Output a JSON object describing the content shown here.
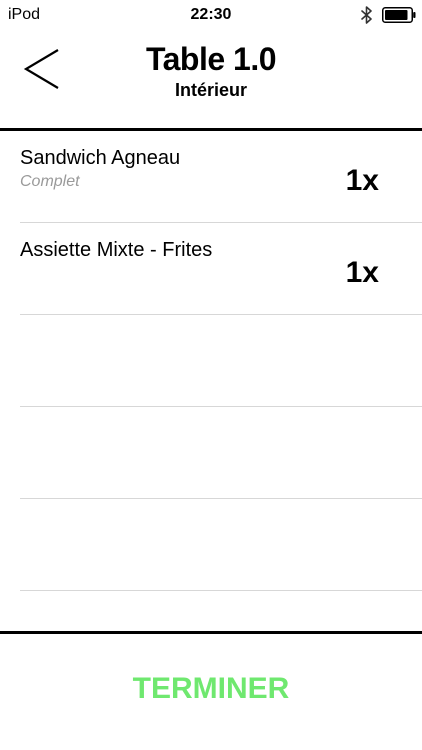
{
  "status_bar": {
    "carrier": "iPod",
    "time": "22:30",
    "bluetooth_icon": "bluetooth-icon",
    "battery_icon": "battery-icon",
    "battery_level": 0.9
  },
  "header": {
    "back_icon": "chevron-left-icon",
    "title": "Table 1.0",
    "subtitle": "Intérieur"
  },
  "order": {
    "items": [
      {
        "name": "Sandwich Agneau",
        "note": "Complet",
        "quantity": "1x"
      },
      {
        "name": "Assiette Mixte - Frites",
        "note": "",
        "quantity": "1x"
      }
    ],
    "empty_rows": 3
  },
  "footer": {
    "finish_label": "TERMINER"
  },
  "colors": {
    "accent": "#6fe86f",
    "note_text": "#9a9a9a",
    "separator": "#d7d7d7",
    "rule": "#000000"
  }
}
